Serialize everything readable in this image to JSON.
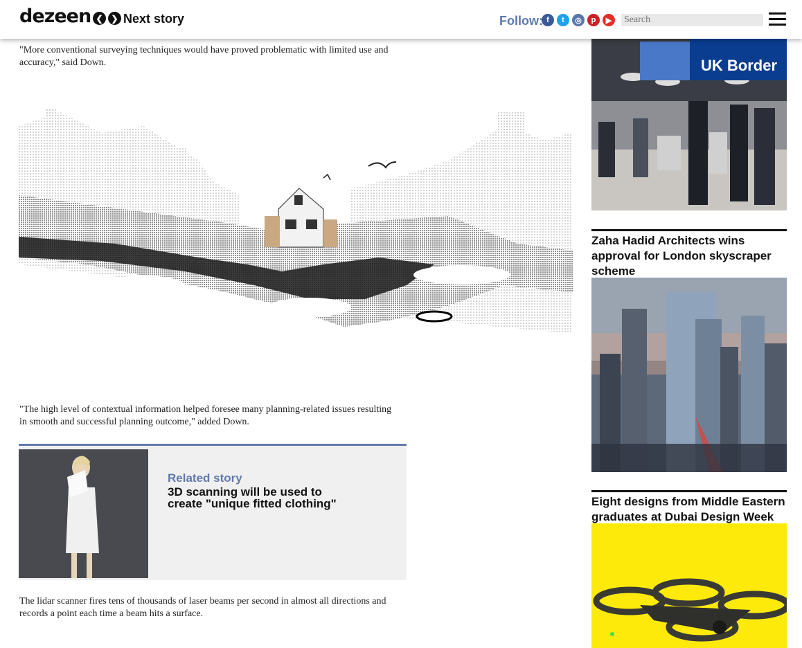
{
  "header": {
    "logo": "dezeen",
    "next_story": "Next story",
    "follow_label": "Follow:",
    "search_placeholder": "Search",
    "socials": [
      {
        "name": "facebook-icon",
        "glyph": "f",
        "color": "#3b5998"
      },
      {
        "name": "twitter-icon",
        "glyph": "t",
        "color": "#1da1f2"
      },
      {
        "name": "instagram-icon",
        "glyph": "◎",
        "color": "#5b76a8"
      },
      {
        "name": "pinterest-icon",
        "glyph": "p",
        "color": "#cb2027"
      },
      {
        "name": "youtube-icon",
        "glyph": "▶",
        "color": "#e52d27"
      }
    ],
    "accent_color": "#5c79ab"
  },
  "article": {
    "para1": "\"More conventional surveying techniques would have proved problematic with limited use and accuracy,\" said Down.",
    "para2": "\"The high level of contextual information helped foresee many planning-related issues resulting in smooth and successful planning outcome,\" added Down.",
    "para3": "The lidar scanner fires tens of thousands of laser beams per second in almost all directions and records a point each time a beam hits a surface.",
    "related": {
      "label": "Related story",
      "title": "3D scanning will be used to create \"unique fitted clothing\""
    }
  },
  "sidebar": {
    "story1_image_sign": "UK Border",
    "story2_title": "Zaha Hadid Architects wins approval for London skyscraper scheme",
    "story3_title": "Eight designs from Middle Eastern graduates at Dubai Design Week"
  }
}
